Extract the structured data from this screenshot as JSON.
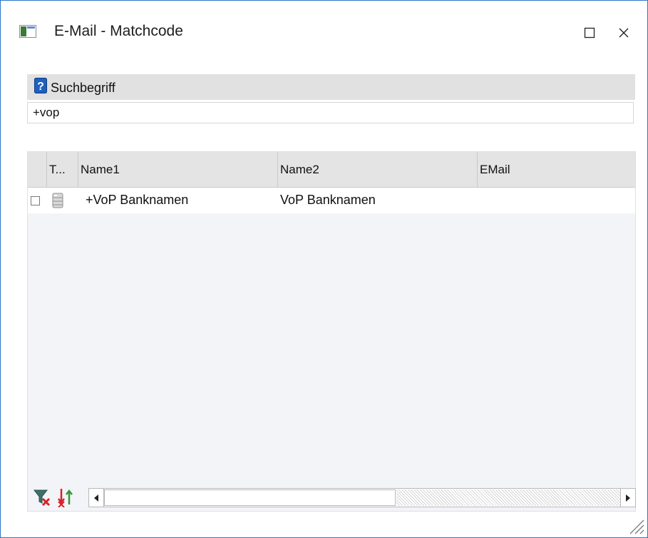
{
  "window": {
    "title": "E-Mail - Matchcode",
    "icons": {
      "app": "window-app-icon",
      "maximize": "maximize-icon",
      "close": "close-icon"
    },
    "accent_color": "#2b78c5"
  },
  "search": {
    "label": "Suchbegriff",
    "value": "+vop",
    "icon": "help-question-icon"
  },
  "grid": {
    "columns": [
      "T...",
      "Name1",
      "Name2",
      "EMail"
    ],
    "rows": [
      {
        "selected": false,
        "type_icon": "database-icon",
        "name1": "+VoP Banknamen",
        "name2": "VoP Banknamen",
        "email": ""
      }
    ]
  },
  "toolbar": {
    "icons": [
      "filter-clear-icon",
      "sort-clear-icon"
    ]
  }
}
